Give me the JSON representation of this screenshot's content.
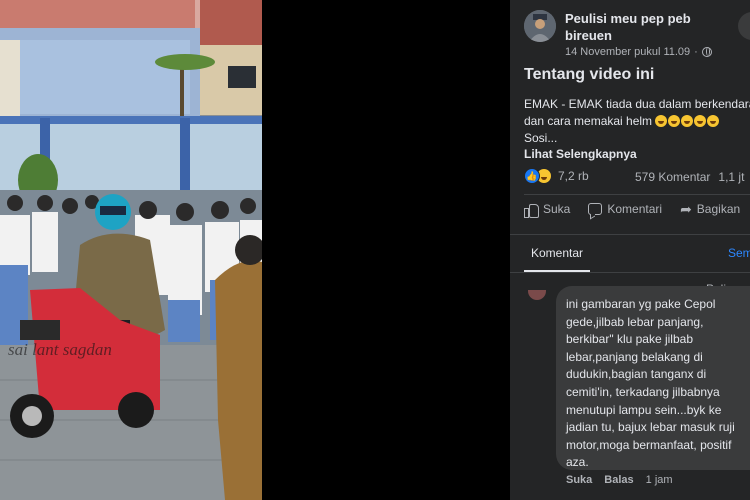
{
  "video": {
    "watermark": "sai lant sagdan"
  },
  "post": {
    "page_name": "Peulisi meu pep peb bireuen",
    "date": "14 November pukul 11.09",
    "privacy_icon": "globe-icon",
    "about_title": "Tentang video ini",
    "description_lines": [
      "EMAK - EMAK tiada dua dalam berkendara",
      "dan cara memakai helm",
      "Sosi..."
    ],
    "see_more": "Lihat Selengkapnya",
    "reaction_count": "7,2 rb",
    "comment_count": "579 Komentar",
    "view_count": "1,1 jt"
  },
  "actions": {
    "like": "Suka",
    "comment": "Komentari",
    "share": "Bagikan"
  },
  "comments": {
    "tab_label": "Komentar",
    "other_tab": "Semua",
    "sort_label": "Paling relevan",
    "comment_lines": [
      "ini gambaran yg pake Cepol",
      "gede,jilbab lebar panjang,",
      "berkibar\" klu pake jilbab",
      "lebar,panjang belakang di",
      "dudukin,bagian tanganx di",
      "cemiti'in, terkadang jilbabnya",
      "menutupi lampu sein...byk ke",
      "jadian tu, bajux lebar masuk ruji",
      "motor,moga bermanfaat, positif",
      "aza."
    ],
    "comment_like": "Suka",
    "comment_reply": "Balas",
    "comment_time": "1 jam"
  }
}
